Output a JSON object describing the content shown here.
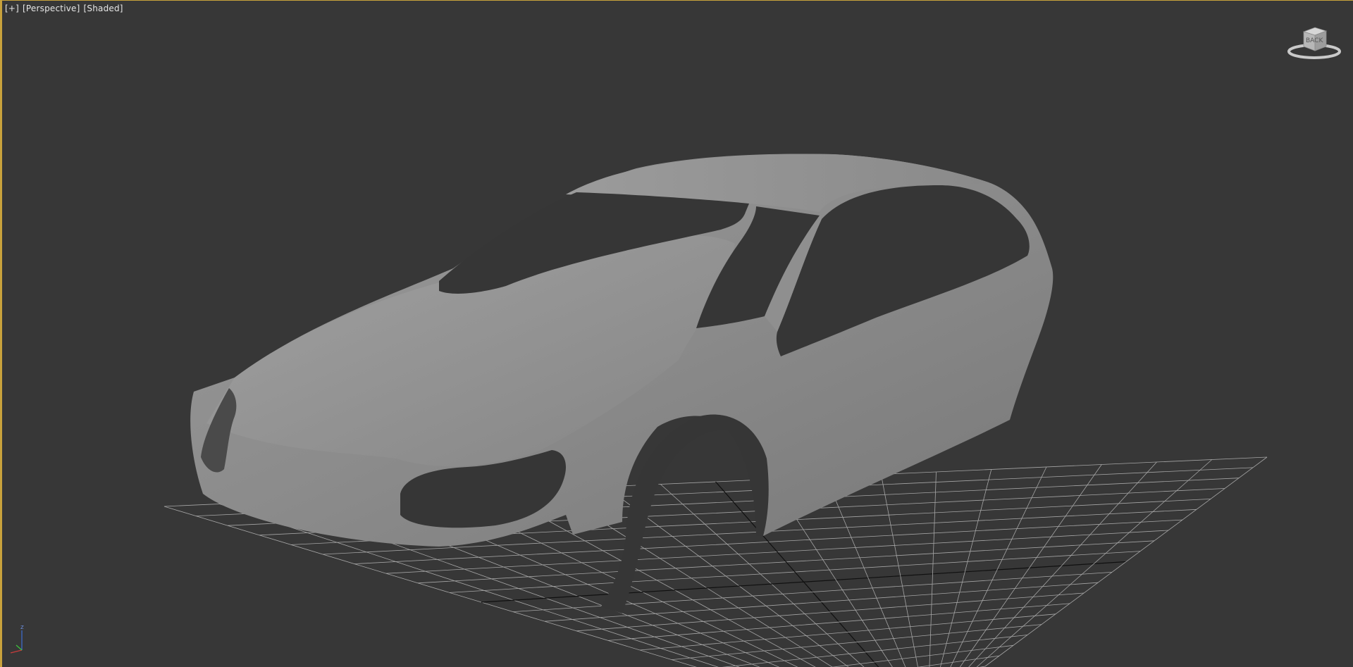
{
  "viewport": {
    "label_plus": "[+]",
    "label_view": "[Perspective]",
    "label_shading": "[Shaded]",
    "viewcube_face": "BACK",
    "axis_z": "z",
    "colors": {
      "active_border": "#c8a23c",
      "background": "#373737",
      "grid": "#a6a6a6",
      "grid_axis": "#101010",
      "model": "#8c8c8c"
    }
  },
  "icons": {
    "viewcube": "viewcube-icon",
    "axis_tripod": "axis-tripod-icon"
  }
}
